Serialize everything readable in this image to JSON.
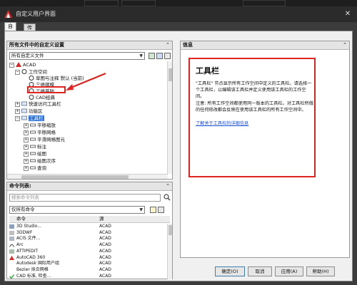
{
  "window": {
    "title": "自定义用户界面",
    "close_glyph": "✕"
  },
  "tabs": [
    {
      "label": "自定义"
    },
    {
      "label": "传输"
    }
  ],
  "left_pane": {
    "header": "所有文件中的自定义设置",
    "collapse": "⌃",
    "combo_value": "所有自定义文件",
    "tree": [
      {
        "label": "ACAD",
        "level": 0,
        "expander": "−"
      },
      {
        "label": "工作空间",
        "level": 1,
        "expander": "−"
      },
      {
        "label": "草图与注释 默认 (当前)",
        "level": 2,
        "expander": ""
      },
      {
        "label": "三维建模",
        "level": 2,
        "expander": ""
      },
      {
        "label": "三维基础",
        "level": 2,
        "expander": ""
      },
      {
        "label": "CAD经典",
        "level": 2,
        "expander": ""
      },
      {
        "label": "快速访问工具栏",
        "level": 1,
        "expander": "+"
      },
      {
        "label": "功能区",
        "level": 1,
        "expander": "+"
      },
      {
        "label": "工具栏",
        "level": 1,
        "expander": "−",
        "selected": true
      },
      {
        "label": "平移缩放",
        "level": 2,
        "expander": "+"
      },
      {
        "label": "平移网格",
        "level": 2,
        "expander": "+"
      },
      {
        "label": "平滑网格图元",
        "level": 2,
        "expander": "+"
      },
      {
        "label": "标注",
        "level": 2,
        "expander": "+"
      },
      {
        "label": "绘图",
        "level": 2,
        "expander": "+"
      },
      {
        "label": "绘图次序",
        "level": 2,
        "expander": "+"
      },
      {
        "label": "查询",
        "level": 2,
        "expander": "+"
      }
    ]
  },
  "cmd_pane": {
    "header": "命令列表:",
    "collapse": "⌃",
    "search_placeholder": "搜索命令列表",
    "filter_value": "仅所有命令",
    "col_command": "命令",
    "col_source": "源",
    "rows": [
      {
        "name": "3D Studio...",
        "source": "ACAD"
      },
      {
        "name": "3DDWF",
        "source": "ACAD"
      },
      {
        "name": "ACIS 文件...",
        "source": "ACAD"
      },
      {
        "name": "Arc",
        "source": "ACAD"
      },
      {
        "name": "ATTIPEDIT",
        "source": "ACAD"
      },
      {
        "name": "AutoCAD 360",
        "source": "ACAD"
      },
      {
        "name": "Autodesk 国际用户组",
        "source": "ACAD"
      },
      {
        "name": "Bezier 拟合网格",
        "source": "ACAD"
      },
      {
        "name": "CAD 标准, 检查...",
        "source": "ACAD"
      },
      {
        "name": "CAD 标准, 配置",
        "source": "ACAD"
      },
      {
        "name": "CAD 标准, 图层转换器",
        "source": "ACAD"
      }
    ]
  },
  "info_pane": {
    "header": "信息",
    "collapse": "⌃",
    "heading": "工具栏",
    "para1": "\"工具栏\" 节点显示所有工作空间中定义的工具栏。请选择一个工具栏，以编辑该工具栏并定义使用该工具栏的工作空间。",
    "para2": "注意: 所有工作空间都使用同一版本的工具栏。对工具栏所做的任何修改都会反映在使用该工具栏的所有工作空间中。",
    "link": "了解关于工具栏的详细信息"
  },
  "buttons": {
    "ok": "确定(O)",
    "cancel": "取消",
    "apply": "应用(A)",
    "help": "帮助(H)"
  },
  "colors": {
    "highlight_red": "#e0241f",
    "selection_blue": "#3074d8",
    "link_blue": "#1a4fd8"
  }
}
